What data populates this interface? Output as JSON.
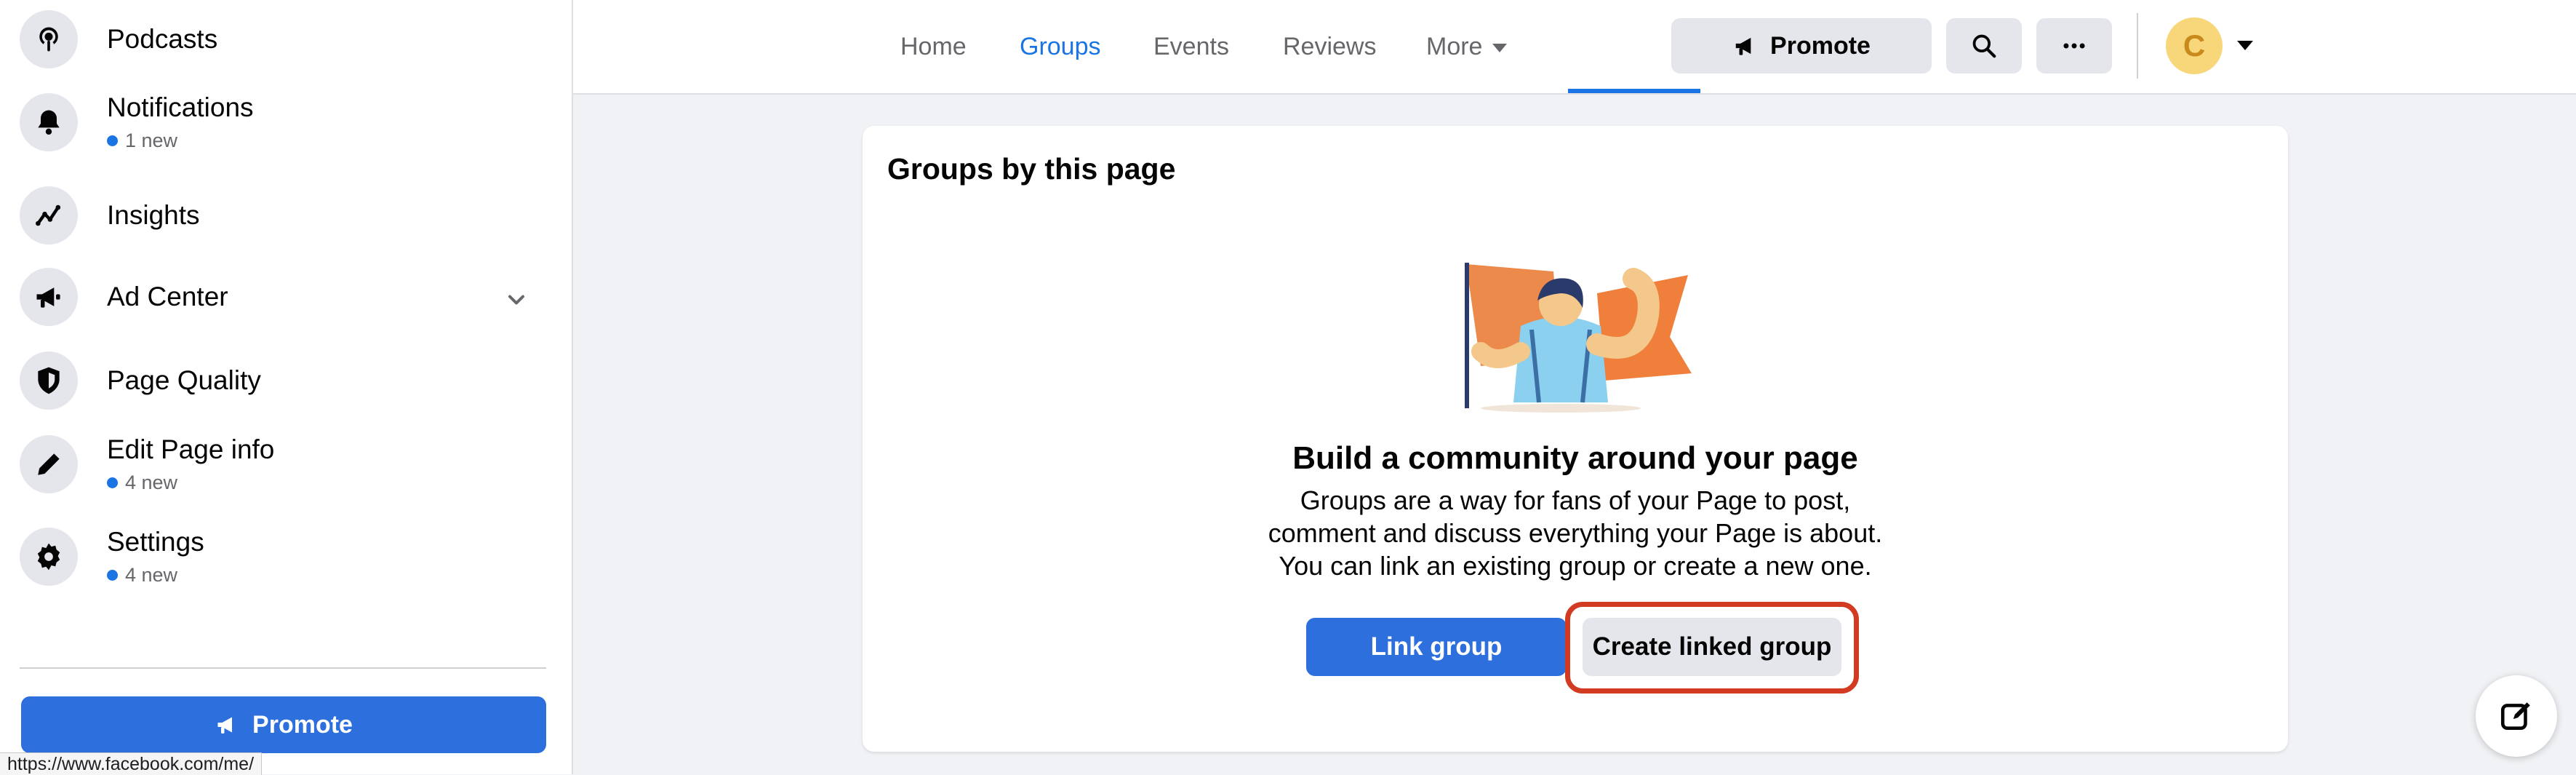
{
  "sidebar": {
    "items": [
      {
        "label": "Podcasts",
        "icon": "podcast-icon",
        "sub": ""
      },
      {
        "label": "Notifications",
        "icon": "bell-icon",
        "sub": "1 new"
      },
      {
        "label": "Insights",
        "icon": "insights-icon",
        "sub": ""
      },
      {
        "label": "Ad Center",
        "icon": "megaphone-icon",
        "sub": ""
      },
      {
        "label": "Page Quality",
        "icon": "shield-icon",
        "sub": ""
      },
      {
        "label": "Edit Page info",
        "icon": "pencil-icon",
        "sub": "4 new"
      },
      {
        "label": "Settings",
        "icon": "gear-icon",
        "sub": "4 new"
      }
    ],
    "promote_label": "Promote"
  },
  "status_url": "https://www.facebook.com/me/",
  "topbar": {
    "tabs": [
      {
        "label": "Home",
        "active": false
      },
      {
        "label": "Groups",
        "active": true
      },
      {
        "label": "Events",
        "active": false
      },
      {
        "label": "Reviews",
        "active": false
      },
      {
        "label": "More",
        "active": false
      }
    ],
    "promote_label": "Promote",
    "avatar_letter": "C"
  },
  "card": {
    "title": "Groups by this page",
    "headline": "Build a community around your page",
    "description_lines": [
      "Groups are a way for fans of your Page to post,",
      "comment and discuss everything your Page is about.",
      "You can link an existing group or create a new one."
    ],
    "link_group_label": "Link group",
    "create_group_label": "Create linked group"
  },
  "colors": {
    "accent": "#1b74e4",
    "primary_button": "#2d6fdc",
    "highlight": "#d23a22",
    "avatar_bg": "#f7d77a"
  }
}
